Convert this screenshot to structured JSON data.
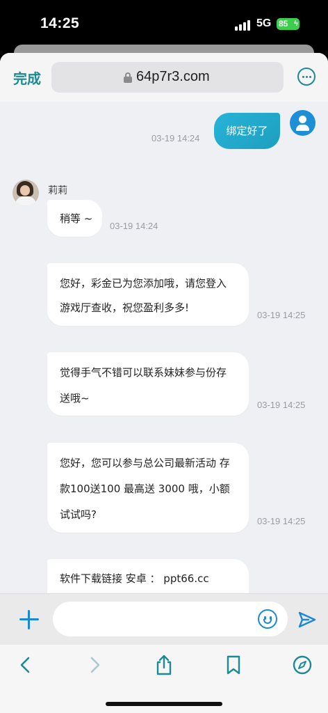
{
  "status_bar": {
    "time": "14:25",
    "network": "5G",
    "battery": "85"
  },
  "browser": {
    "done_label": "完成",
    "url": "64p7r3.com"
  },
  "chat": {
    "outgoing": [
      {
        "text": "绑定好了",
        "time": "03-19 14:24"
      }
    ],
    "agent_name": "莉莉",
    "incoming": [
      {
        "lines": [
          "稍等 ~"
        ],
        "time": "03-19 14:24"
      },
      {
        "lines": [
          "您好，彩金已为您添加哦，请您登入",
          "游戏厅查收，祝您盈利多多!"
        ],
        "time": "03-19 14:25"
      },
      {
        "lines": [
          "觉得手气不错可以联系妹妹参与份存",
          "送哦~"
        ],
        "time": "03-19 14:25"
      },
      {
        "lines": [
          "您好，您可以参与总公司最新活动 存",
          "款100送100 最高送 3000 哦，小额",
          "试试吗?"
        ],
        "time": "03-19 14:25"
      },
      {
        "lines": [
          "软件下载链接 安卓 ： ppt66.cc"
        ],
        "time": ""
      }
    ]
  },
  "input": {
    "placeholder": ""
  },
  "colors": {
    "accent": "#1c8a94",
    "bubble_out": "#26b3d8",
    "icon_blue": "#1a88d6"
  },
  "icons": {
    "toolbar": [
      "lock-icon",
      "more-icon"
    ],
    "input": [
      "plus-icon",
      "emoji-icon",
      "send-icon"
    ],
    "nav": [
      "back-icon",
      "forward-icon",
      "share-icon",
      "bookmarks-icon",
      "compass-icon"
    ]
  }
}
